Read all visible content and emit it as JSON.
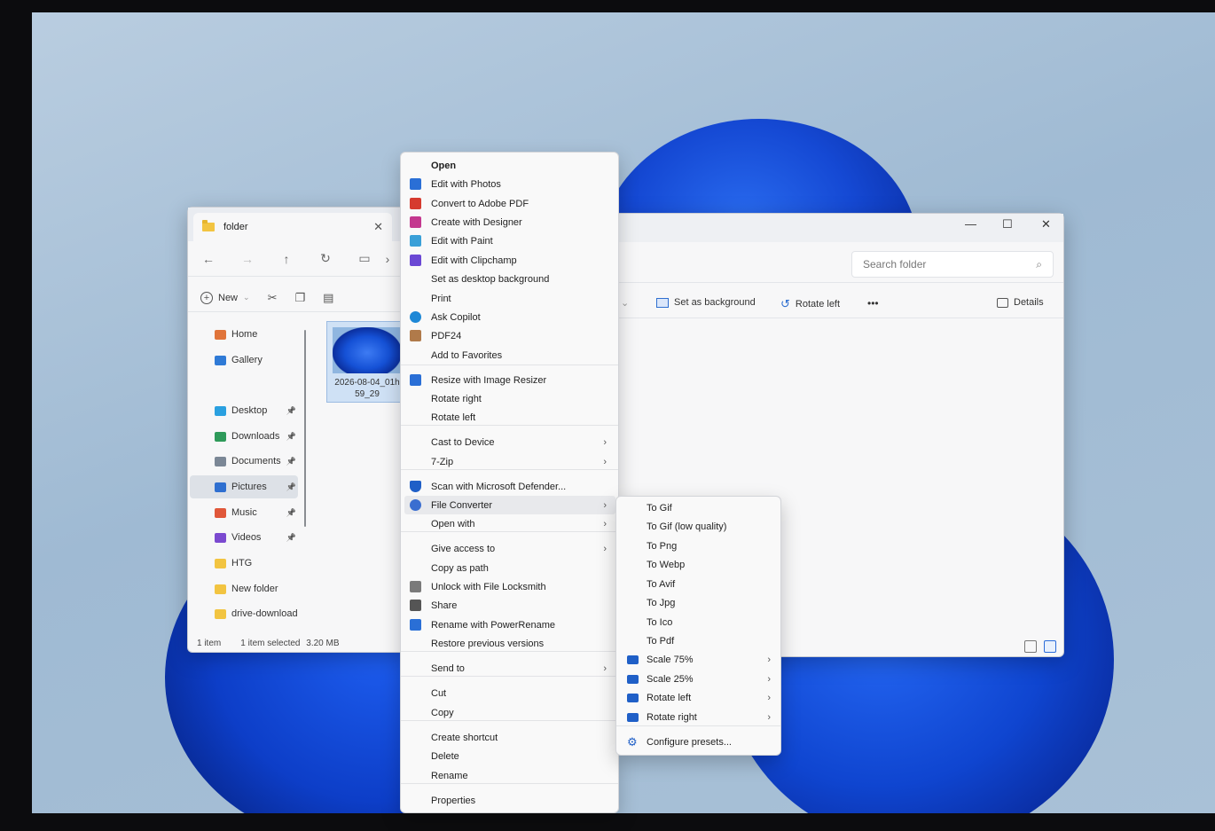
{
  "colors": {
    "accent": "#1f5fc7",
    "wallpaper": "#a9c1d7",
    "menu_bg": "#f9f9f9"
  },
  "explorer": {
    "tab_title": "folder",
    "nav": {
      "back_icon": "arrow-left-icon",
      "forward_icon": "arrow-right-icon",
      "up_icon": "arrow-up-icon",
      "refresh_icon": "refresh-icon",
      "pc_icon": "monitor-icon",
      "chevron": "›"
    },
    "toolbar": {
      "new_label": "New",
      "new_caret": "⌄"
    },
    "sidebar": [
      {
        "label": "Home",
        "icon": "home-icon",
        "color": "#e0743a"
      },
      {
        "label": "Gallery",
        "icon": "gallery-icon",
        "color": "#2f7ad6"
      },
      {
        "label": "Desktop",
        "icon": "desktop-icon",
        "color": "#2aa0e0",
        "pinned": true
      },
      {
        "label": "Downloads",
        "icon": "download-icon",
        "color": "#2e9a5a",
        "pinned": true
      },
      {
        "label": "Documents",
        "icon": "documents-icon",
        "color": "#7b8796",
        "pinned": true
      },
      {
        "label": "Pictures",
        "icon": "pictures-icon",
        "color": "#2f6fd0",
        "pinned": true
      },
      {
        "label": "Music",
        "icon": "music-icon",
        "color": "#e0573a",
        "pinned": true
      },
      {
        "label": "Videos",
        "icon": "videos-icon",
        "color": "#7b4ad0",
        "pinned": true
      },
      {
        "label": "HTG",
        "icon": "folder-icon",
        "color": "#f2c441"
      },
      {
        "label": "New folder",
        "icon": "folder-icon",
        "color": "#f2c441"
      },
      {
        "label": "drive-download",
        "icon": "folder-icon",
        "color": "#f2c441"
      }
    ],
    "file": {
      "name_line1": "2026-08-04_01h",
      "name_line2": "59_29"
    },
    "status": {
      "count": "1 item",
      "selected": "1 item selected",
      "size": "3.20 MB"
    },
    "search_placeholder": "Search folder",
    "cmd": {
      "set_bg": "Set as background",
      "rotate_left": "Rotate left",
      "more": "•••",
      "details": "Details"
    },
    "window_controls": {
      "minimize": "—",
      "maximize": "☐",
      "close": "✕"
    }
  },
  "context_menu": {
    "items": [
      {
        "label": "Open",
        "bold": true
      },
      {
        "label": "Edit with Photos",
        "icon": "photos-icon",
        "color": "#2a6fd6"
      },
      {
        "label": "Convert to Adobe PDF",
        "icon": "adobe-pdf-icon",
        "color": "#d63b2f"
      },
      {
        "label": "Create with Designer",
        "icon": "designer-icon",
        "color": "#c4388f"
      },
      {
        "label": "Edit with Paint",
        "icon": "paint-icon",
        "color": "#3aa0d8"
      },
      {
        "label": "Edit with Clipchamp",
        "icon": "clipchamp-icon",
        "color": "#6b48d4"
      },
      {
        "label": "Set as desktop background"
      },
      {
        "label": "Print"
      },
      {
        "label": "Ask Copilot",
        "icon": "copilot-icon",
        "color": "#1e88d6"
      },
      {
        "label": "PDF24",
        "icon": "pdf24-icon",
        "color": "#b07a4a"
      },
      {
        "label": "Add to Favorites"
      },
      {
        "label": "Resize with Image Resizer",
        "icon": "image-resizer-icon",
        "color": "#2a6fd6"
      },
      {
        "label": "Rotate right"
      },
      {
        "label": "Rotate left"
      },
      {
        "label": "Cast to Device",
        "submenu": true
      },
      {
        "label": "7-Zip",
        "submenu": true
      },
      {
        "label": "Scan with Microsoft Defender...",
        "icon": "defender-shield-icon",
        "color": "#1f5fc7"
      },
      {
        "label": "File Converter",
        "icon": "file-converter-icon",
        "color": "#3a6ed0",
        "submenu": true,
        "hover": true
      },
      {
        "label": "Open with",
        "submenu": true
      },
      {
        "label": "Give access to",
        "submenu": true
      },
      {
        "label": "Copy as path"
      },
      {
        "label": "Unlock with File Locksmith",
        "icon": "lock-icon",
        "color": "#7a7a7a"
      },
      {
        "label": "Share",
        "icon": "share-icon",
        "color": "#555555"
      },
      {
        "label": "Rename with PowerRename",
        "icon": "power-rename-icon",
        "color": "#2a6fd6"
      },
      {
        "label": "Restore previous versions"
      },
      {
        "label": "Send to",
        "submenu": true
      },
      {
        "label": "Cut"
      },
      {
        "label": "Copy"
      },
      {
        "label": "Create shortcut"
      },
      {
        "label": "Delete"
      },
      {
        "label": "Rename"
      },
      {
        "label": "Properties"
      }
    ]
  },
  "submenu": {
    "items": [
      {
        "label": "To Gif"
      },
      {
        "label": "To Gif (low quality)"
      },
      {
        "label": "To Png"
      },
      {
        "label": "To Webp"
      },
      {
        "label": "To Avif"
      },
      {
        "label": "To Jpg"
      },
      {
        "label": "To Ico"
      },
      {
        "label": "To Pdf"
      },
      {
        "label": "Scale 75%",
        "icon": "folder-icon",
        "submenu": true
      },
      {
        "label": "Scale 25%",
        "icon": "folder-icon",
        "submenu": true
      },
      {
        "label": "Rotate left",
        "icon": "folder-icon",
        "submenu": true
      },
      {
        "label": "Rotate right",
        "icon": "folder-icon",
        "submenu": true
      },
      {
        "label": "Configure presets...",
        "icon": "gear-icon"
      }
    ]
  }
}
